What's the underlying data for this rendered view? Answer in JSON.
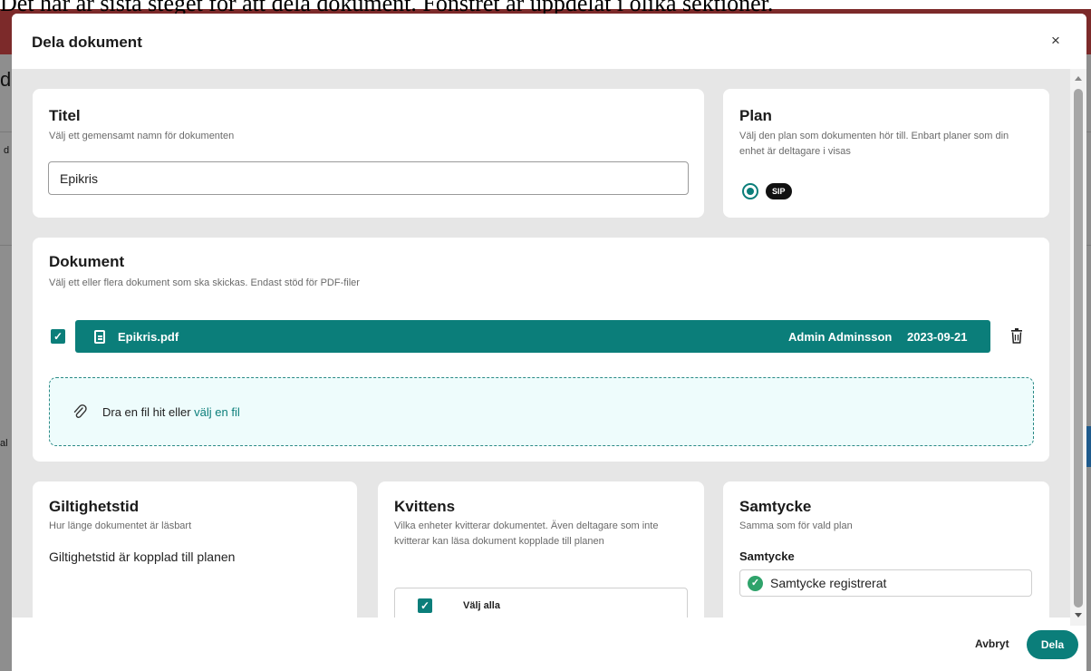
{
  "caption": "Det här är sista steget för att dela dokument. Fönstret är uppdelat i olika sektioner.",
  "background": {
    "fragments": [
      "d",
      "d",
      "al"
    ]
  },
  "modal": {
    "title": "Dela dokument",
    "close_glyph": "×"
  },
  "title_section": {
    "heading": "Titel",
    "description": "Välj ett gemensamt namn för dokumenten",
    "input_value": "Epikris"
  },
  "plan_section": {
    "heading": "Plan",
    "description": "Välj den plan som dokumenten hör till. Enbart planer som din enhet är deltagare i visas",
    "selected_plan": "SIP"
  },
  "documents_section": {
    "heading": "Dokument",
    "description": "Välj ett eller flera dokument som ska skickas. Endast stöd för PDF-filer",
    "files": [
      {
        "name": "Epikris.pdf",
        "author": "Admin Adminsson",
        "date": "2023-09-21",
        "checked": true
      }
    ],
    "dropzone_text": "Dra en fil hit eller ",
    "dropzone_link": "välj en fil"
  },
  "validity_section": {
    "heading": "Giltighetstid",
    "description": "Hur länge dokumentet är läsbart",
    "text": "Giltighetstid är kopplad till planen"
  },
  "receipt_section": {
    "heading": "Kvittens",
    "description": "Vilka enheter kvitterar dokumentet. Även deltagare som inte kvitterar kan läsa dokument kopplade till planen",
    "select_all_label": "Välj alla"
  },
  "consent_section": {
    "heading": "Samtycke",
    "description": "Samma som för vald plan",
    "label": "Samtycke",
    "status": "Samtycke registrerat"
  },
  "footer": {
    "cancel_label": "Avbryt",
    "share_label": "Dela"
  },
  "colors": {
    "accent": "#0b7e7a",
    "success": "#2fa36b",
    "background_overlay": "#8e8e8e"
  }
}
